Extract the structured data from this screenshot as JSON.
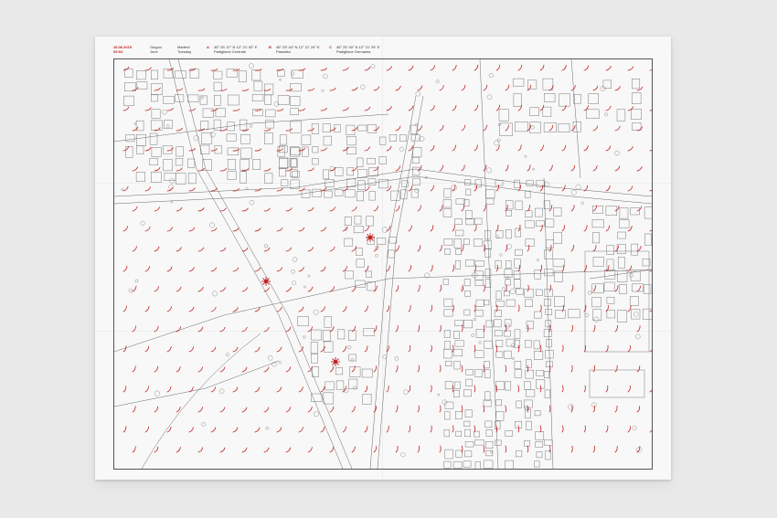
{
  "header": {
    "date": "16.06.2015",
    "time": "09:04",
    "month_it": "Giugno",
    "month_en": "June",
    "weekday_it": "Martedì",
    "weekday_en": "Tuesday",
    "markers": [
      {
        "letter": "A",
        "coord": "45° 25' 47\" N  12° 21' 52\" E",
        "name": "Padiglione Centrale"
      },
      {
        "letter": "B",
        "coord": "45° 25' 44\" N  12° 21' 24\" E",
        "name": "Paradiso"
      },
      {
        "letter": "C",
        "coord": "45° 25' 40\" N  12° 21' 29\" E",
        "name": "Padiglione Germania"
      }
    ]
  },
  "colors": {
    "background": "#e9e9e9",
    "paper": "#f8f8f8",
    "accent_red": "#c42020",
    "linework": "#6a6a6a"
  },
  "map": {
    "features": [
      "street-grid",
      "building-footprints",
      "tree-circles",
      "wind-vector-field",
      "location-markers"
    ],
    "marker_icons": [
      "compass-star-icon",
      "compass-star-icon",
      "compass-star-icon"
    ]
  }
}
